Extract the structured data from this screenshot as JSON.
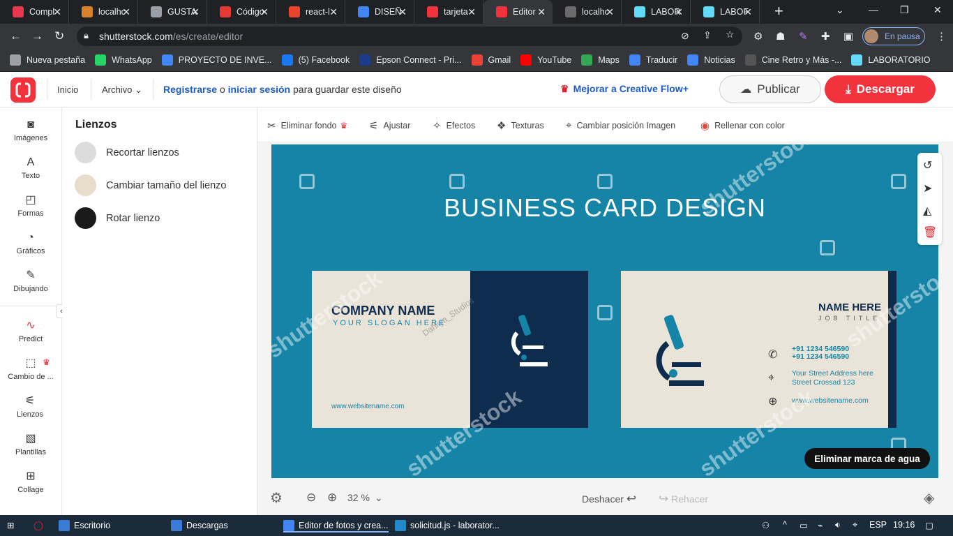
{
  "browser": {
    "tabs": [
      {
        "title": "Compl",
        "color": "#e8384f"
      },
      {
        "title": "localhc",
        "color": "#d9822b"
      },
      {
        "title": "GUSTA",
        "color": "#9aa0a6"
      },
      {
        "title": "Código",
        "color": "#e53935"
      },
      {
        "title": "react-l",
        "color": "#e8452c"
      },
      {
        "title": "DISEÑ",
        "color": "#4285f4"
      },
      {
        "title": "tarjeta",
        "color": "#f2323c"
      },
      {
        "title": "Editor",
        "color": "#f2323c"
      },
      {
        "title": "localhc",
        "color": "#6b6b6b"
      },
      {
        "title": "LABOR",
        "color": "#61dafb"
      },
      {
        "title": "LABOF",
        "color": "#61dafb"
      }
    ],
    "url_domain": "shutterstock.com",
    "url_path": "/es/create/editor",
    "profile_label": "En pausa",
    "bookmarks": [
      {
        "label": "Nueva pestaña",
        "color": "#9aa0a6"
      },
      {
        "label": "WhatsApp",
        "color": "#25d366"
      },
      {
        "label": "PROYECTO DE INVE...",
        "color": "#4285f4"
      },
      {
        "label": "(5) Facebook",
        "color": "#1877f2"
      },
      {
        "label": "Epson Connect - Pri...",
        "color": "#1a3c8c"
      },
      {
        "label": "Gmail",
        "color": "#ea4335"
      },
      {
        "label": "YouTube",
        "color": "#ff0000"
      },
      {
        "label": "Maps",
        "color": "#34a853"
      },
      {
        "label": "Traducir",
        "color": "#4285f4"
      },
      {
        "label": "Noticias",
        "color": "#4285f4"
      },
      {
        "label": "Cine Retro y Más -...",
        "color": "#555555"
      },
      {
        "label": "LABORATORIO",
        "color": "#61dafb"
      }
    ]
  },
  "header": {
    "inicio": "Inicio",
    "archivo": "Archivo",
    "register": "Registrarse",
    "or": "o",
    "login": "iniciar sesión",
    "save_text": "para guardar este diseño",
    "upgrade": "Mejorar a Creative Flow+",
    "publish": "Publicar",
    "download": "Descargar"
  },
  "rail": {
    "items": [
      {
        "label": "Imágenes",
        "icon": "camera-icon",
        "glyph": "◙"
      },
      {
        "label": "Texto",
        "icon": "text-icon",
        "glyph": "A"
      },
      {
        "label": "Formas",
        "icon": "shapes-icon",
        "glyph": "◰"
      },
      {
        "label": "Gráficos",
        "icon": "graphics-icon",
        "glyph": "◔"
      },
      {
        "label": "Dibujando",
        "icon": "pencil-icon",
        "glyph": "✎"
      },
      {
        "label": "Predict",
        "icon": "predict-icon",
        "glyph": "∿"
      },
      {
        "label": "Cambio de ...",
        "icon": "resize-icon",
        "glyph": "⬚"
      },
      {
        "label": "Lienzos",
        "icon": "sliders-icon",
        "glyph": "⚟"
      },
      {
        "label": "Plantillas",
        "icon": "templates-icon",
        "glyph": "▧"
      },
      {
        "label": "Collage",
        "icon": "collage-icon",
        "glyph": "⊞"
      }
    ]
  },
  "panel": {
    "title": "Lienzos",
    "items": [
      {
        "label": "Recortar lienzos",
        "color": "#dcdcdc"
      },
      {
        "label": "Cambiar tamaño del lienzo",
        "color": "#e8dccb"
      },
      {
        "label": "Rotar lienzo",
        "color": "#1a1a1a"
      }
    ]
  },
  "toolbar": {
    "items": [
      {
        "label": "Eliminar fondo",
        "icon": "scissors-icon",
        "glyph": "✂"
      },
      {
        "label": "Ajustar",
        "icon": "adjust-icon",
        "glyph": "⚟"
      },
      {
        "label": "Efectos",
        "icon": "wand-icon",
        "glyph": "✧"
      },
      {
        "label": "Texturas",
        "icon": "texture-icon",
        "glyph": "❖"
      },
      {
        "label": "Cambiar posición Imagen",
        "icon": "position-icon",
        "glyph": "⌖"
      },
      {
        "label": "Rellenar con color",
        "icon": "color-wheel-icon",
        "glyph": "◉"
      }
    ]
  },
  "canvas": {
    "headline": "BUSINESS CARD DESIGN",
    "watermark": "shutterstock",
    "left_card": {
      "company": "COMPANY NAME",
      "slogan": "YOUR SLOGAN HERE",
      "web": "www.websitename.com",
      "credit": "Dahliya_Studios"
    },
    "right_card": {
      "name": "NAME HERE",
      "job": "JOB TITLE",
      "phone1": "+91 1234 546590",
      "phone2": "+91 1234 546590",
      "addr1": "Your Street Address here",
      "addr2": "Street Crossad 123",
      "web": "www.websitename.com"
    },
    "remove_watermark": "Eliminar marca de agua",
    "bg_color": "#1584a7",
    "dark_color": "#0e2c4d"
  },
  "footer": {
    "zoom": "32 %",
    "undo": "Deshacer",
    "redo": "Rehacer"
  },
  "taskbar": {
    "items": [
      {
        "label": "Escritorio",
        "color": "#3a7bd5"
      },
      {
        "label": "Descargas",
        "color": "#3a7bd5"
      },
      {
        "label": "Editor de fotos y crea...",
        "color": "#4285f4"
      },
      {
        "label": "solicitud.js - laborator...",
        "color": "#2489ca"
      }
    ],
    "lang": "ESP",
    "time": "19:16"
  }
}
